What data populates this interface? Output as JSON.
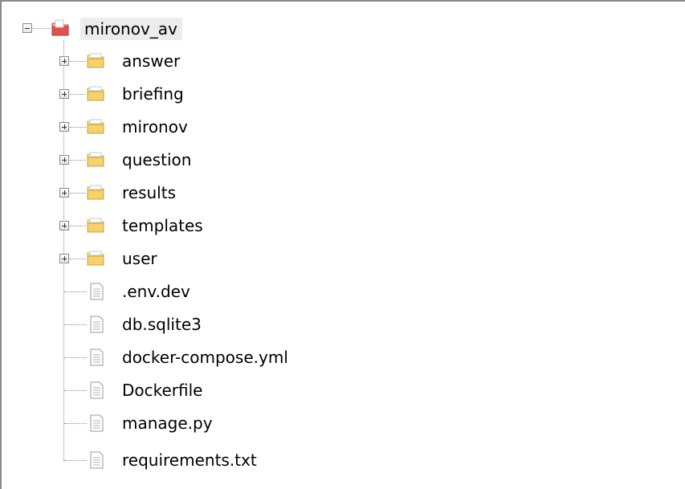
{
  "tree": {
    "root": {
      "label": "mironov_av",
      "icon": "project-folder-icon",
      "expanded": true
    },
    "folders": [
      {
        "label": "answer",
        "icon": "folder-icon",
        "expanded": false
      },
      {
        "label": "briefing",
        "icon": "folder-icon",
        "expanded": false
      },
      {
        "label": "mironov",
        "icon": "folder-icon",
        "expanded": false
      },
      {
        "label": "question",
        "icon": "folder-icon",
        "expanded": false
      },
      {
        "label": "results",
        "icon": "folder-icon",
        "expanded": false
      },
      {
        "label": "templates",
        "icon": "folder-icon",
        "expanded": false
      },
      {
        "label": "user",
        "icon": "folder-icon",
        "expanded": false
      }
    ],
    "files": [
      {
        "label": ".env.dev",
        "icon": "file-icon"
      },
      {
        "label": "db.sqlite3",
        "icon": "file-icon"
      },
      {
        "label": "docker-compose.yml",
        "icon": "file-icon"
      },
      {
        "label": "Dockerfile",
        "icon": "file-icon"
      },
      {
        "label": "manage.py",
        "icon": "file-icon"
      },
      {
        "label": "requirements.txt",
        "icon": "file-icon"
      }
    ]
  },
  "colors": {
    "root_highlight": "#ececec",
    "folder": "#f5d36b",
    "project_folder": "#e0524f",
    "connector": "#8c8c8c"
  }
}
